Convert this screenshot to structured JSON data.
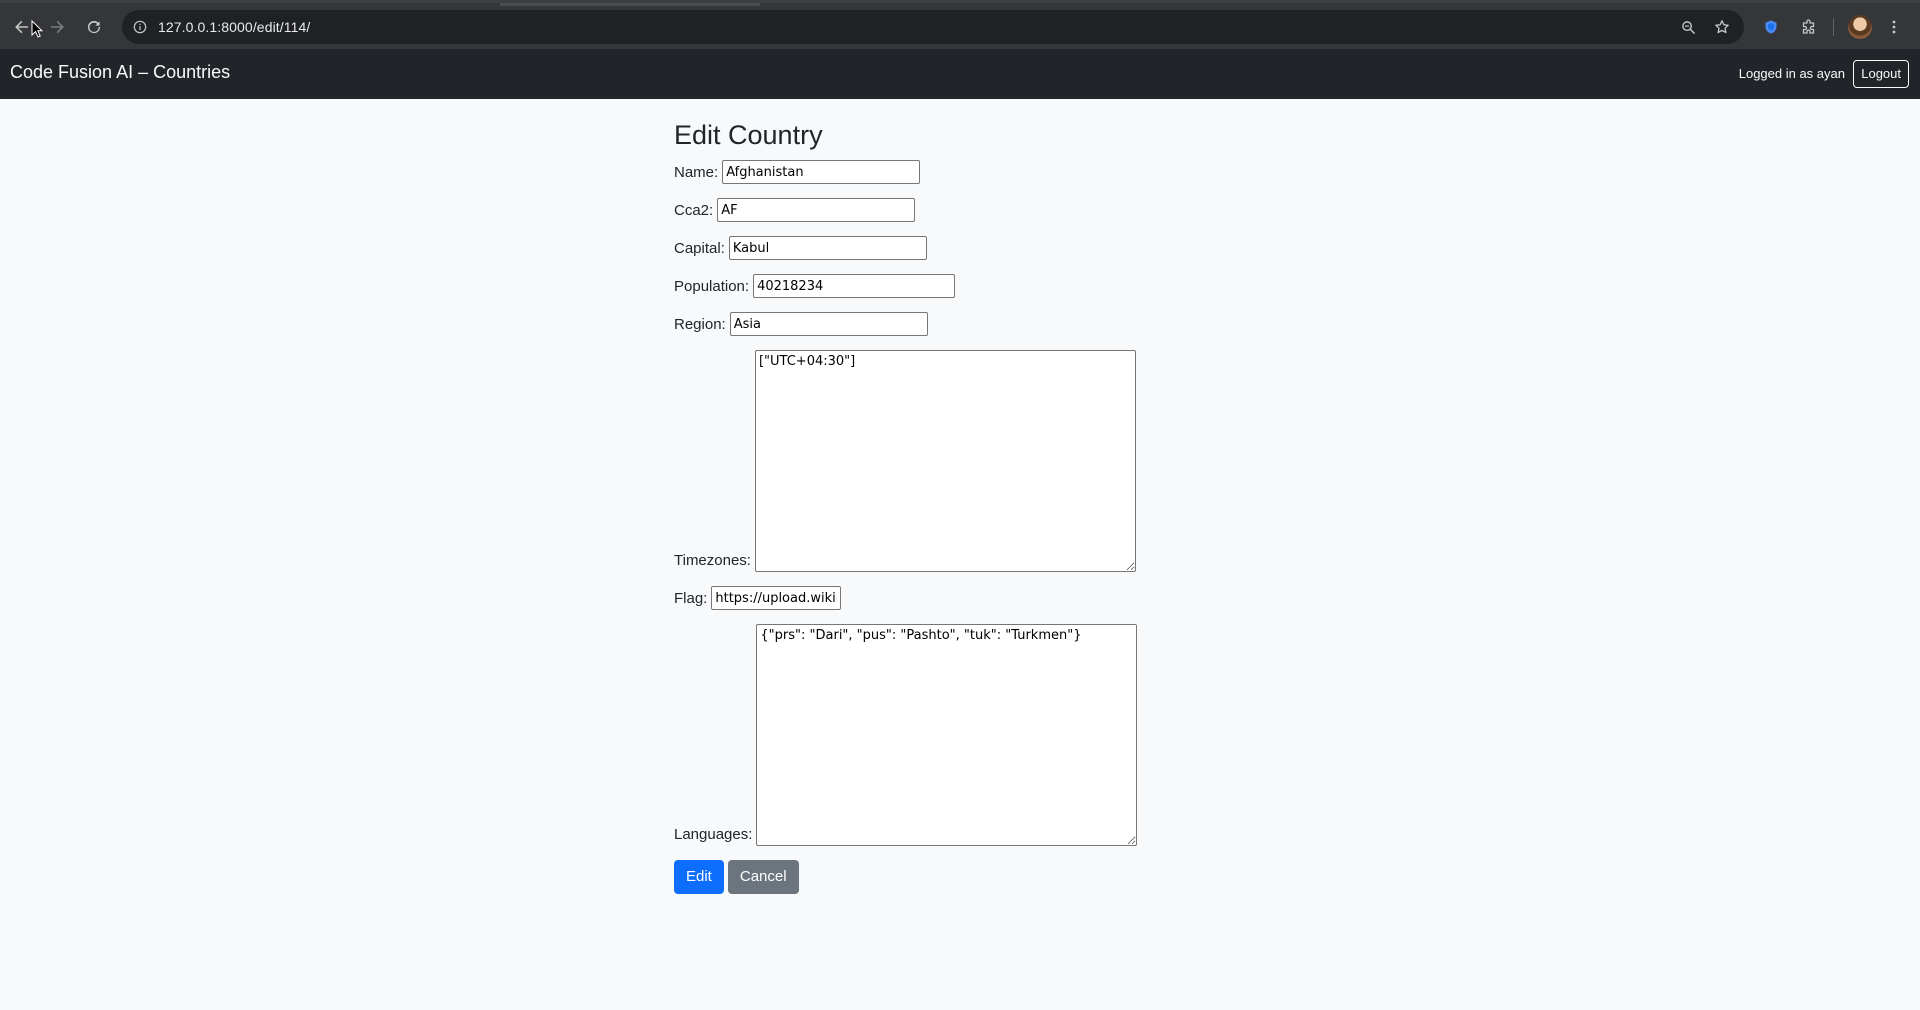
{
  "browser": {
    "url": "127.0.0.1:8000/edit/114/"
  },
  "navbar": {
    "brand": "Code Fusion AI – Countries",
    "login_text": "Logged in as ayan",
    "logout_label": "Logout"
  },
  "page": {
    "title": "Edit Country"
  },
  "form": {
    "name": {
      "label": "Name:",
      "value": "Afghanistan"
    },
    "cca2": {
      "label": "Cca2:",
      "value": "AF"
    },
    "capital": {
      "label": "Capital:",
      "value": "Kabul"
    },
    "population": {
      "label": "Population:",
      "value": "40218234"
    },
    "region": {
      "label": "Region:",
      "value": "Asia"
    },
    "timezones": {
      "label": "Timezones:",
      "value": "[\"UTC+04:30\"]"
    },
    "flag": {
      "label": "Flag:",
      "value": "https://upload.wikimedia.org/"
    },
    "languages": {
      "label": "Languages:",
      "value": "{\"prs\": \"Dari\", \"pus\": \"Pashto\", \"tuk\": \"Turkmen\"}"
    },
    "edit_label": "Edit",
    "cancel_label": "Cancel"
  },
  "colors": {
    "navbar_bg": "#212529",
    "primary": "#0d6efd",
    "secondary": "#6c757d",
    "page_bg": "#f8f9fa"
  }
}
